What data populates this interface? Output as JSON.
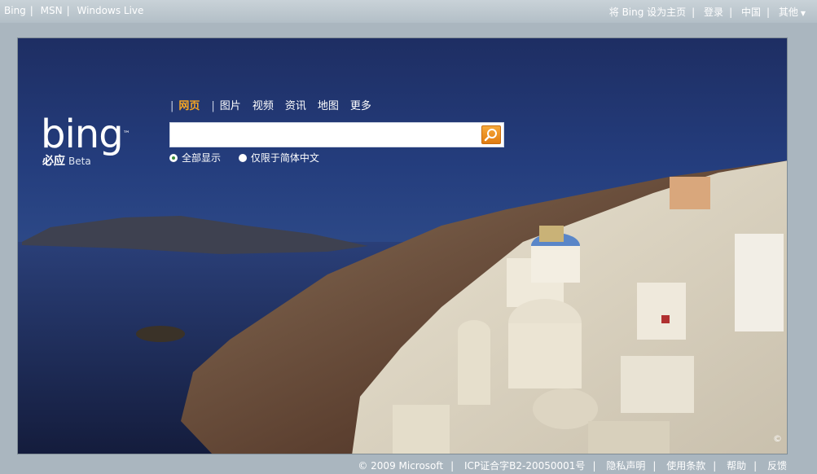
{
  "topbar": {
    "left_links": [
      "Bing",
      "MSN",
      "Windows Live"
    ],
    "set_homepage": "将 Bing 设为主页",
    "login": "登录",
    "region": "中国",
    "more": "其他"
  },
  "logo": {
    "word": "bing",
    "tagline": "必应",
    "beta": "Beta"
  },
  "nav": {
    "tabs": [
      "网页",
      "图片",
      "视频",
      "资讯",
      "地图",
      "更多"
    ],
    "active_index": 0
  },
  "search": {
    "value": "",
    "placeholder": ""
  },
  "scope": {
    "options": [
      "全部显示",
      "仅限于简体中文"
    ],
    "selected_index": 0
  },
  "hero": {
    "copyright_mark": "©"
  },
  "footer": {
    "copyright": "© 2009 Microsoft",
    "icp": "ICP证合字B2-20050001号",
    "privacy": "隐私声明",
    "terms": "使用条款",
    "help": "帮助",
    "feedback": "反馈"
  },
  "colors": {
    "accent": "#f5a623",
    "sky": "#243d7d",
    "frame": "#aab6bf"
  }
}
